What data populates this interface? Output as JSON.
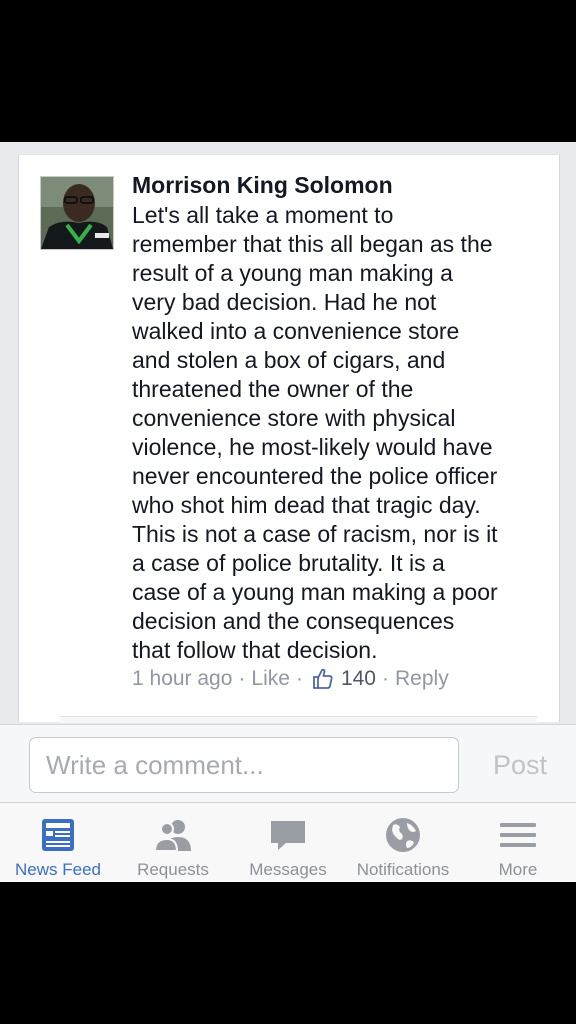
{
  "comment": {
    "author": "Morrison King Solomon",
    "lines": [
      "Let's all take a moment to",
      "remember that this all began as the",
      "result of a young man making a",
      "very bad decision. Had he not",
      "walked into a convenience store",
      "and stolen a box of cigars, and",
      "threatened the owner of the",
      "convenience store with physical",
      "violence, he most-likely would have",
      "never encountered the police officer",
      "who shot him dead that tragic day.",
      "This is not a case of racism, nor is it",
      "a case of police brutality. It is a",
      "case of a young man making a poor",
      "decision and the consequences",
      "that follow that decision."
    ],
    "timestamp": "1 hour ago",
    "separator": "·",
    "like_label": "Like",
    "like_count": "140",
    "reply_label": "Reply",
    "like_icon": "thumbs-up-icon"
  },
  "composer": {
    "placeholder": "Write a comment...",
    "post_label": "Post"
  },
  "tabbar": {
    "active_color": "#3b6fc4",
    "inactive_color": "#8d9096",
    "tabs": [
      {
        "label": "News Feed",
        "icon": "news-feed-icon",
        "active": true
      },
      {
        "label": "Requests",
        "icon": "friend-requests-icon",
        "active": false
      },
      {
        "label": "Messages",
        "icon": "messages-icon",
        "active": false
      },
      {
        "label": "Notifications",
        "icon": "globe-icon",
        "active": false
      },
      {
        "label": "More",
        "icon": "menu-icon",
        "active": false
      }
    ]
  }
}
